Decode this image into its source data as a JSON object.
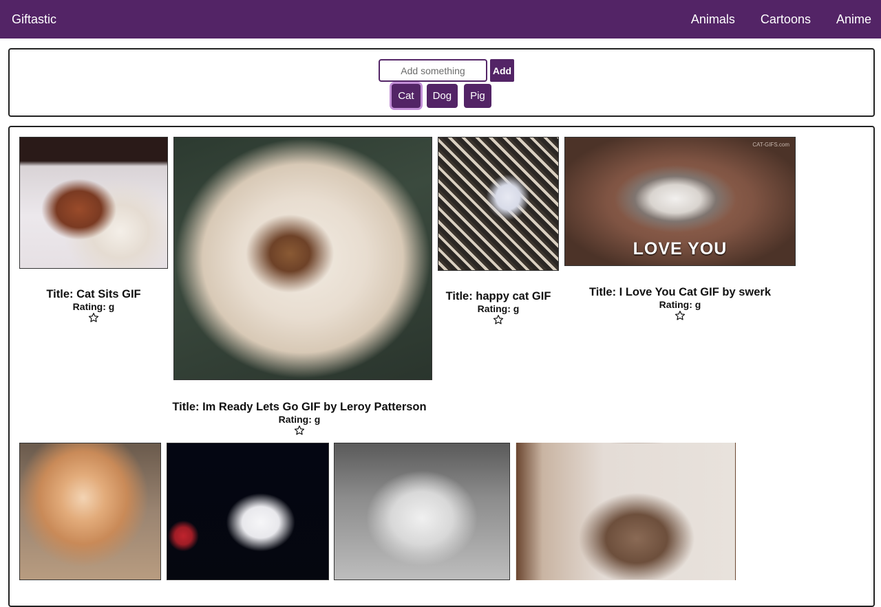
{
  "app": {
    "brand": "Giftastic",
    "nav": [
      "Animals",
      "Cartoons",
      "Anime"
    ]
  },
  "search": {
    "placeholder": "Add something",
    "value": "",
    "add_label": "Add"
  },
  "topics": {
    "items": [
      "Cat",
      "Dog",
      "Pig"
    ],
    "active": "Cat"
  },
  "gifs": [
    {
      "title": "Title: Cat Sits GIF",
      "rating": "Rating: g",
      "favorite": false
    },
    {
      "title": "Title: Im Ready Lets Go GIF by Leroy Patterson",
      "rating": "Rating: g",
      "favorite": false
    },
    {
      "title": "Title: happy cat GIF",
      "rating": "Rating: g",
      "favorite": false
    },
    {
      "title": "Title: I Love You Cat GIF by swerk",
      "rating": "Rating: g",
      "favorite": false,
      "overlay_text": "LOVE YOU",
      "watermark": "CAT-GIFS.com"
    },
    {
      "title": "",
      "rating": "",
      "favorite": false
    },
    {
      "title": "",
      "rating": "",
      "favorite": false
    },
    {
      "title": "",
      "rating": "",
      "favorite": false
    },
    {
      "title": "",
      "rating": "",
      "favorite": false
    }
  ],
  "colors": {
    "brand": "#532466",
    "active_outline": "#c28ed6"
  },
  "icons": {
    "favorite": "star-outline-icon"
  }
}
